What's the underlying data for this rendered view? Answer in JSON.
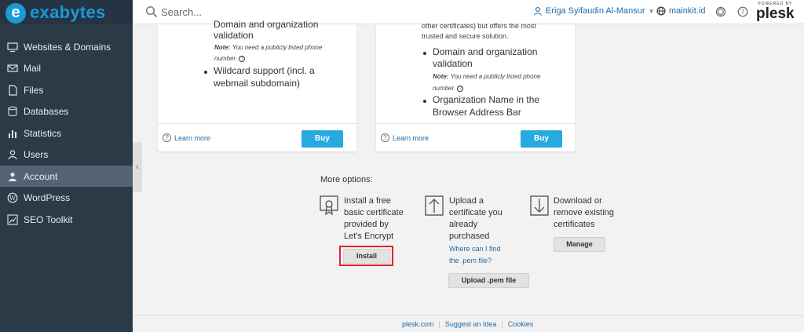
{
  "header": {
    "brand_letter": "e",
    "brand_name": "exabytes",
    "search_placeholder": "Search...",
    "user_name": "Eriga Syifaudin Al-Mansur",
    "domain": "mainkit.id",
    "powered_by": "POWERED BY",
    "plesk": "plesk"
  },
  "sidebar": {
    "items": [
      {
        "label": "Websites & Domains",
        "icon": "monitor-icon"
      },
      {
        "label": "Mail",
        "icon": "mail-icon"
      },
      {
        "label": "Files",
        "icon": "file-icon"
      },
      {
        "label": "Databases",
        "icon": "database-icon"
      },
      {
        "label": "Statistics",
        "icon": "bar-chart-icon"
      },
      {
        "label": "Users",
        "icon": "user-icon"
      },
      {
        "label": "Account",
        "icon": "account-icon"
      },
      {
        "label": "WordPress",
        "icon": "wordpress-icon"
      },
      {
        "label": "SEO Toolkit",
        "icon": "seo-icon"
      }
    ],
    "active": "Account",
    "collapse_glyph": "‹"
  },
  "card_left": {
    "line1": "Domain and organization",
    "line2": "validation",
    "note_label": "Note:",
    "note_text": "You need a publicly listed phone",
    "note_text2": "number.",
    "bullet2_line1": "Wildcard support (incl. a",
    "bullet2_line2": "webmail subdomain)",
    "learn_more": "Learn more",
    "buy": "Buy"
  },
  "card_right": {
    "intro1": "other certificates) but offers the most",
    "intro2": "trusted and secure solution.",
    "bullet1_line1": "Domain and organization",
    "bullet1_line2": "validation",
    "note_label": "Note:",
    "note_text": "You need a publicly listed phone",
    "note_text2": "number.",
    "bullet2_line1": "Organization Name in the",
    "bullet2_line2": "Browser Address Bar",
    "learn_more": "Learn more",
    "buy": "Buy"
  },
  "more_options": {
    "title": "More options:",
    "install": {
      "lines": [
        "Install a free",
        "basic certificate",
        "provided by",
        "Let's Encrypt"
      ],
      "button": "Install"
    },
    "upload": {
      "lines": [
        "Upload a",
        "certificate you",
        "already",
        "purchased"
      ],
      "link1": "Where can I find",
      "link2": "the .pem file?",
      "button": "Upload .pem file"
    },
    "download": {
      "lines": [
        "Download or",
        "remove existing",
        "certificates"
      ],
      "button": "Manage"
    }
  },
  "footer": {
    "links": [
      "plesk.com",
      "Suggest an Idea",
      "Cookies"
    ]
  },
  "colors": {
    "sidebar": "#2b3a47",
    "active": "#536373",
    "accent": "#28a9e0",
    "link": "#1e6aa8",
    "highlight": "#e4222a"
  }
}
